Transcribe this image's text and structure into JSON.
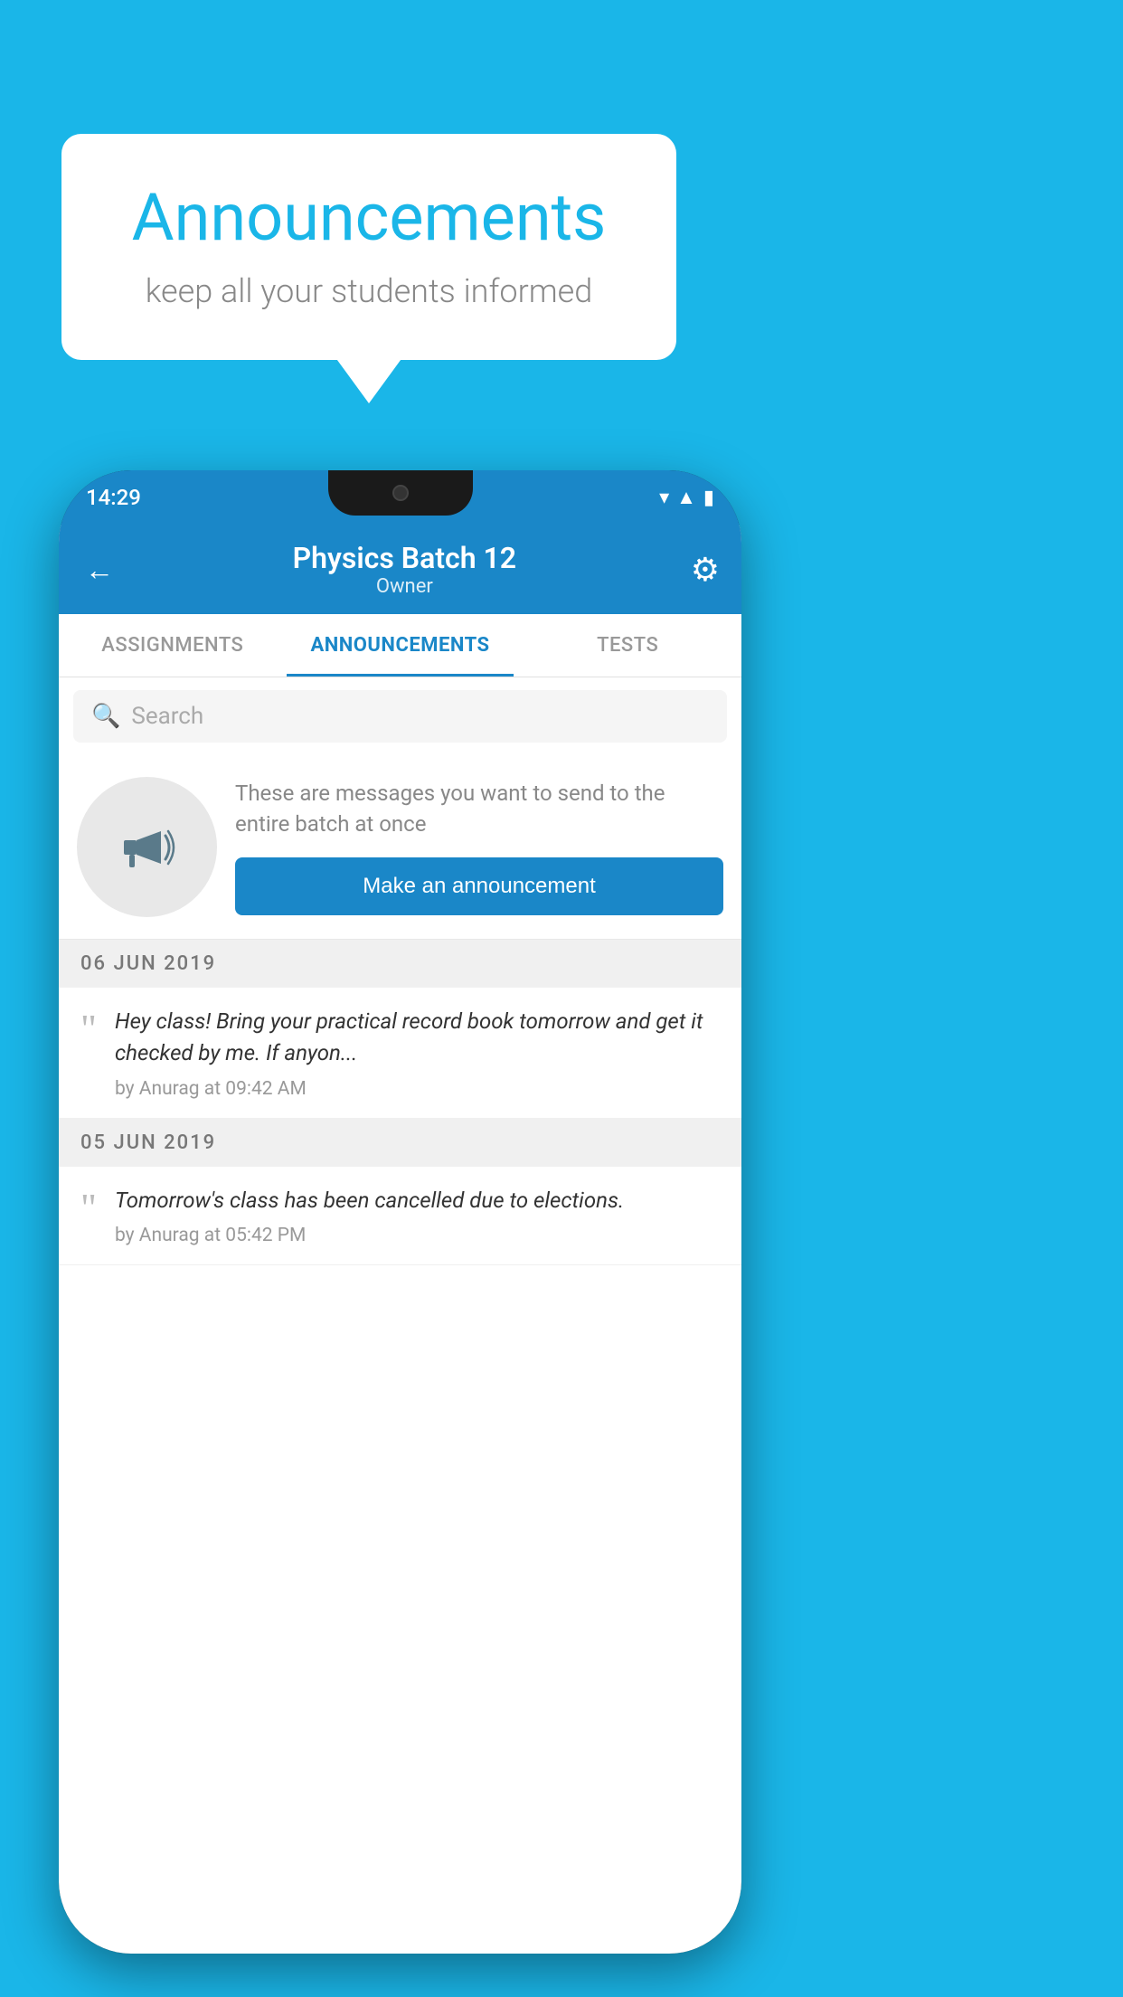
{
  "background_color": "#1ab6e8",
  "speech_bubble": {
    "title": "Announcements",
    "subtitle": "keep all your students informed"
  },
  "phone": {
    "status_bar": {
      "time": "14:29",
      "icons": [
        "wifi",
        "signal",
        "battery"
      ]
    },
    "header": {
      "back_label": "←",
      "title": "Physics Batch 12",
      "subtitle": "Owner",
      "settings_label": "⚙"
    },
    "tabs": [
      {
        "label": "ASSIGNMENTS",
        "active": false
      },
      {
        "label": "ANNOUNCEMENTS",
        "active": true
      },
      {
        "label": "TESTS",
        "active": false
      }
    ],
    "search": {
      "placeholder": "Search"
    },
    "promo": {
      "description": "These are messages you want to send to the entire batch at once",
      "button_label": "Make an announcement"
    },
    "announcements": [
      {
        "date": "06  JUN  2019",
        "text": "Hey class! Bring your practical record book tomorrow and get it checked by me. If anyon...",
        "meta": "by Anurag at 09:42 AM"
      },
      {
        "date": "05  JUN  2019",
        "text": "Tomorrow's class has been cancelled due to elections.",
        "meta": "by Anurag at 05:42 PM"
      }
    ]
  }
}
